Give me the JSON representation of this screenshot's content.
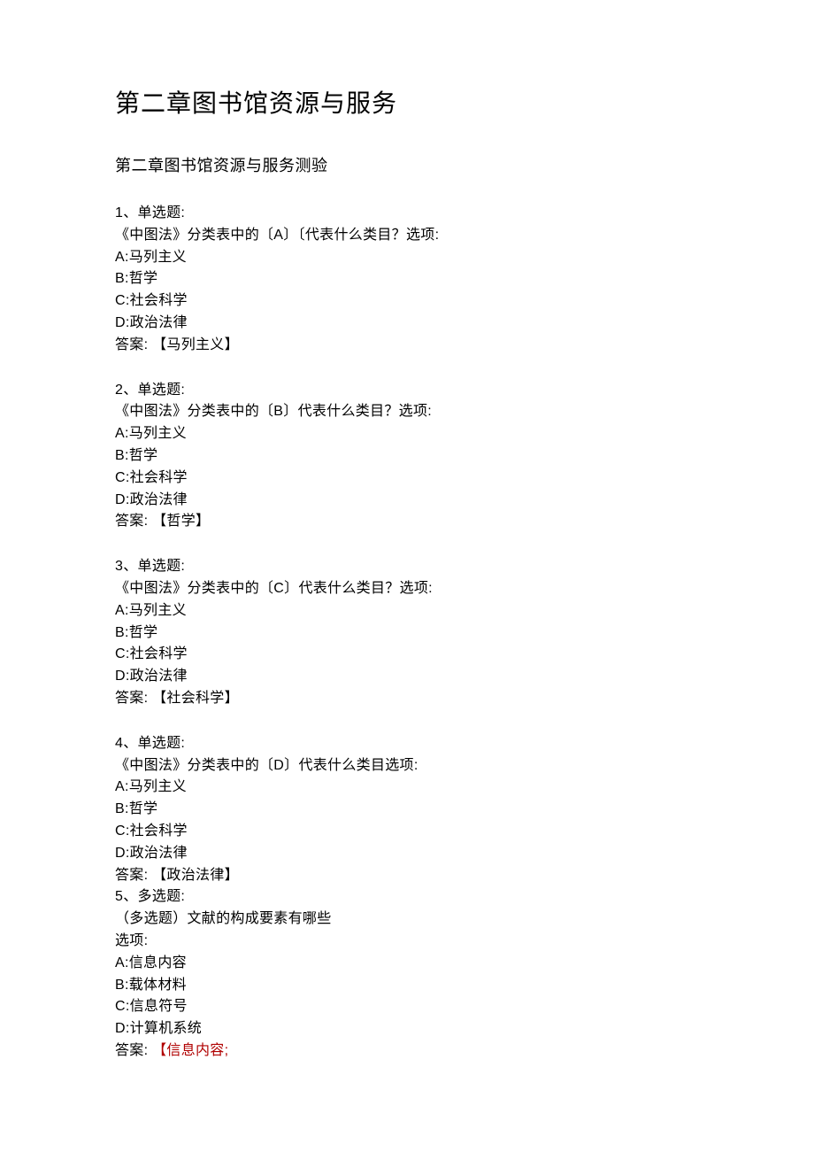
{
  "mainTitle": "第二章图书馆资源与服务",
  "subTitle": "第二章图书馆资源与服务测验",
  "questions": [
    {
      "number": "1、单选题:",
      "stem": "《中图法》分类表中的〔A〕〔代表什么类目？选项:",
      "options": [
        "A:马列主义",
        "B:哲学",
        "C:社会科学",
        "D:政治法律"
      ],
      "answerLabel": "答案: 【马列主义】"
    },
    {
      "number": "2、单选题:",
      "stem": "《中图法》分类表中的〔B〕代表什么类目？选项:",
      "options": [
        "A:马列主义",
        "B:哲学",
        "C:社会科学",
        "D:政治法律"
      ],
      "answerLabel": "答案: 【哲学】"
    },
    {
      "number": "3、单选题:",
      "stem": "《中图法》分类表中的〔C〕代表什么类目？选项:",
      "options": [
        "A:马列主义",
        "B:哲学",
        "C:社会科学",
        "D:政治法律"
      ],
      "answerLabel": "答案: 【社会科学】"
    },
    {
      "number": "4、单选题:",
      "stem": "《中图法》分类表中的〔D〕代表什么类目选项:",
      "options": [
        "A:马列主义",
        "B:哲学",
        "C:社会科学",
        "D:政治法律"
      ],
      "answerLabel": "答案: 【政治法律】"
    },
    {
      "number": "5、多选题:",
      "stem": "（多选题）文献的构成要素有哪些",
      "stem2": "选项:",
      "options": [
        "A:信息内容",
        "B:载体材料",
        "C:信息符号",
        "D:计算机系统"
      ],
      "answerLabelPrefix": "答案: ",
      "answerHighlight": "【信息内容;"
    }
  ]
}
